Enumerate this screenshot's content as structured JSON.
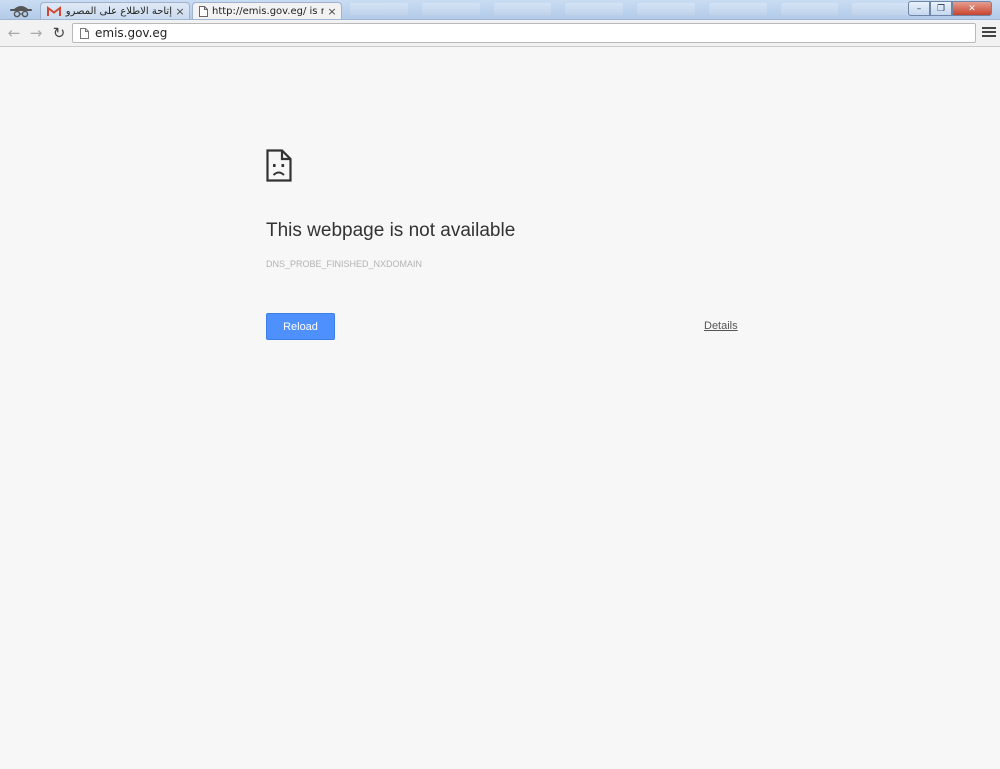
{
  "tabs": [
    {
      "title": "إتاحة الاطلاع على المصروفات الد",
      "icon": "gmail-icon",
      "active": false,
      "close_label": "×"
    },
    {
      "title": "http://emis.gov.eg/ is not",
      "icon": "page-icon",
      "active": true,
      "close_label": "×"
    }
  ],
  "window_controls": {
    "minimize": "–",
    "maximize": "❐",
    "close": "✕"
  },
  "toolbar": {
    "back_icon": "←",
    "forward_icon": "→",
    "reload_icon": "↻",
    "url": "emis.gov.eg"
  },
  "error": {
    "title": "This webpage is not available",
    "code": "DNS_PROBE_FINISHED_NXDOMAIN",
    "reload_label": "Reload",
    "details_label": "Details"
  },
  "colors": {
    "reload_button": "#4d90fe",
    "page_background": "#f7f7f7"
  }
}
